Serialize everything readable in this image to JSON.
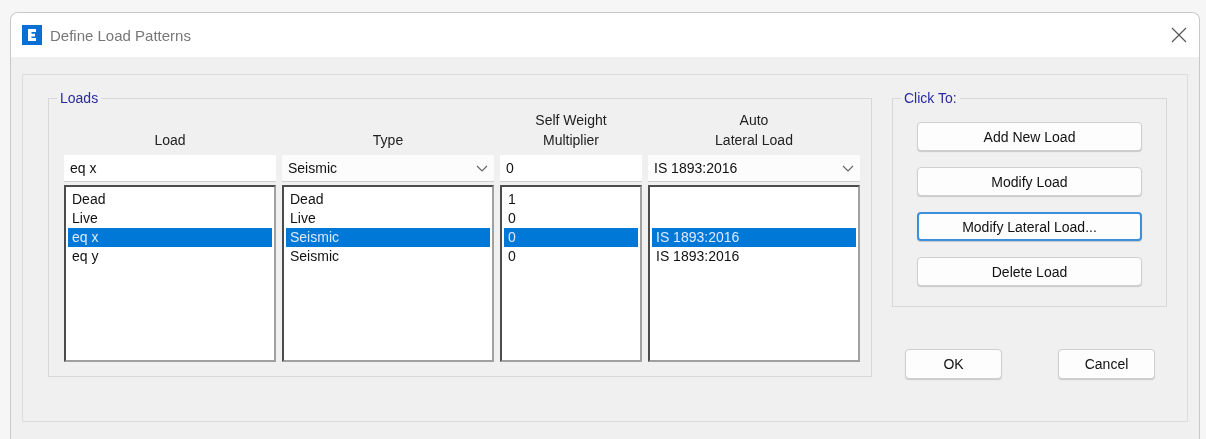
{
  "window": {
    "title": "Define Load Patterns"
  },
  "loads": {
    "legend": "Loads",
    "columns": [
      "Load",
      "Type",
      "Self Weight\nMultiplier",
      "Auto\nLateral Load"
    ],
    "edit": {
      "load": "eq x",
      "type": "Seismic",
      "multiplier": "0",
      "auto_lateral": "IS 1893:2016"
    },
    "rows": [
      {
        "load": "Dead",
        "type": "Dead",
        "multiplier": "1",
        "selected": false
      },
      {
        "load": "Live",
        "type": "Live",
        "multiplier": "0",
        "selected": false
      },
      {
        "load": "eq x",
        "type": "Seismic",
        "multiplier": "0",
        "auto_lateral": "IS 1893:2016",
        "selected": true
      },
      {
        "load": "eq y",
        "type": "Seismic",
        "multiplier": "0",
        "auto_lateral": "IS 1893:2016",
        "selected": false
      }
    ]
  },
  "click_to": {
    "legend": "Click To:",
    "buttons": [
      {
        "label": "Add New Load",
        "focused": false
      },
      {
        "label": "Modify Load",
        "focused": false
      },
      {
        "label": "Modify Lateral Load...",
        "focused": true
      },
      {
        "label": "Delete Load",
        "focused": false
      }
    ]
  },
  "ok": "OK",
  "cancel": "Cancel"
}
